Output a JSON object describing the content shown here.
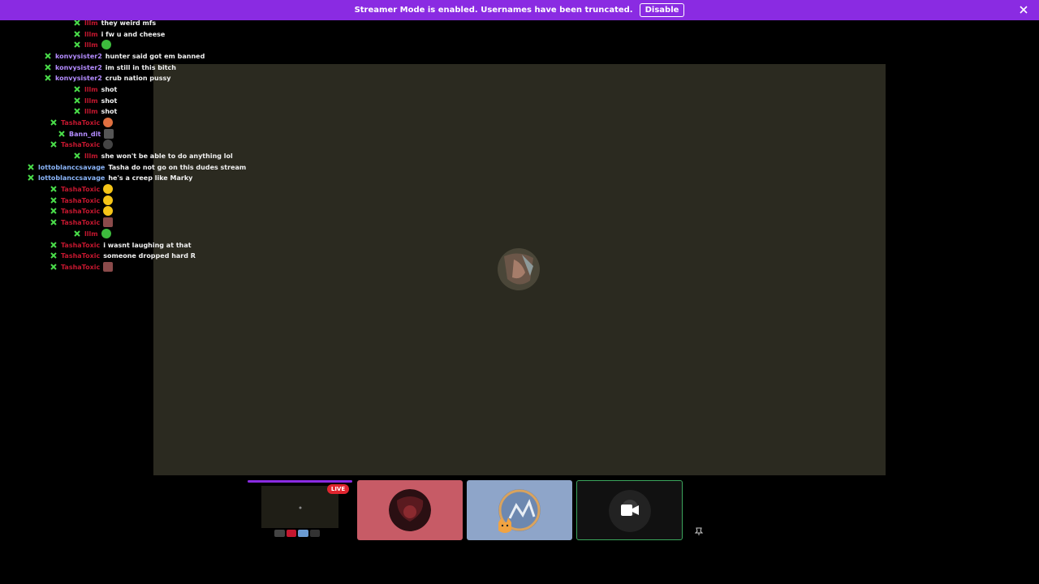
{
  "banner": {
    "text": "Streamer Mode is enabled. Usernames have been truncated.",
    "button_label": "Disable"
  },
  "colors": {
    "accent": "#8a2be2",
    "live": "#e0252f",
    "mod_badge": "#4ade4a",
    "user_red": "#c4172f",
    "user_purple": "#b48cff",
    "user_blue": "#8ab4f8"
  },
  "stream": {
    "live_label": "LIVE"
  },
  "chat": {
    "messages": [
      {
        "user": "lllm",
        "text": "",
        "emote": "avatar-emote"
      },
      {
        "user": "lllm",
        "text": "they weird mfs"
      },
      {
        "user": "lllm",
        "text": "i fw u and cheese"
      },
      {
        "user": "lllm",
        "text": "",
        "emote": "green-emote"
      },
      {
        "user": "konvysister2",
        "text": "hunter said got em banned"
      },
      {
        "user": "konvysister2",
        "text": "im still in this bitch"
      },
      {
        "user": "konvysister2",
        "text": "crub nation pussy"
      },
      {
        "user": "lllm",
        "text": "shot"
      },
      {
        "user": "lllm",
        "text": "shot"
      },
      {
        "user": "lllm",
        "text": "shot"
      },
      {
        "user": "TashaToxic",
        "text": "",
        "emote": "peach-emote"
      },
      {
        "user": "Bann_dit",
        "text": "",
        "emote": "photo-emote"
      },
      {
        "user": "TashaToxic",
        "text": "",
        "emote": "spider-emote"
      },
      {
        "user": "lllm",
        "text": "she won't be able to do anything lol"
      },
      {
        "user": "lottoblanccsavage",
        "text": "Tasha do not go on this dudes stream"
      },
      {
        "user": "lottoblanccsavage",
        "text": "he's a creep like Marky"
      },
      {
        "user": "TashaToxic",
        "text": "",
        "emote": "yellow-emote"
      },
      {
        "user": "TashaToxic",
        "text": "",
        "emote": "yellow-emote"
      },
      {
        "user": "TashaToxic",
        "text": "",
        "emote": "yellow-emote"
      },
      {
        "user": "TashaToxic",
        "text": "",
        "emote": "photo-emote"
      },
      {
        "user": "lllm",
        "text": "",
        "emote": "green-emote"
      },
      {
        "user": "TashaToxic",
        "text": "i wasnt laughing at that"
      },
      {
        "user": "TashaToxic",
        "text": "someone dropped hard R"
      },
      {
        "user": "TashaToxic",
        "text": "",
        "emote": "photo-emote"
      }
    ]
  }
}
